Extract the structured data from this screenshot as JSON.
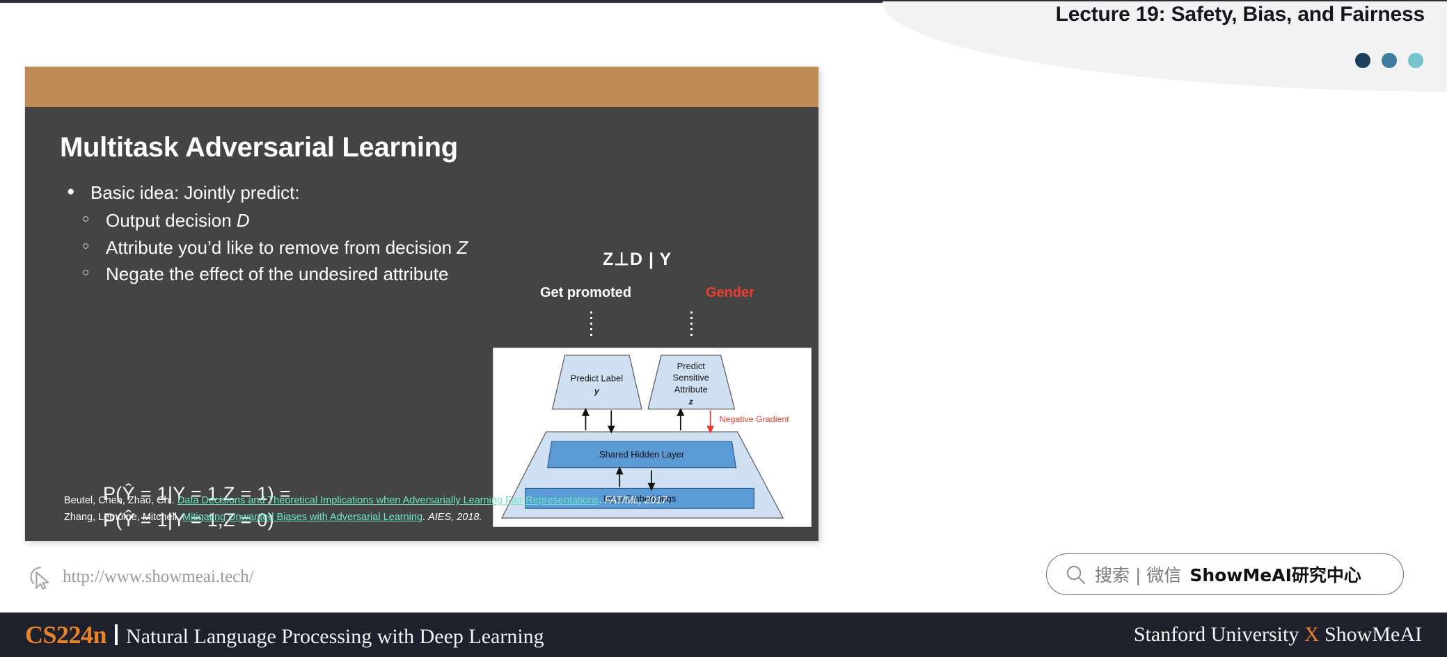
{
  "header": {
    "title": "Lecture 19: Safety, Bias, and Fairness",
    "dots": [
      "dot-dark-navy",
      "dot-steel-blue",
      "dot-light-cyan"
    ]
  },
  "slide": {
    "title": "Multitask Adversarial Learning",
    "accent_band_color": "#bf8c58",
    "background_color": "#444444",
    "bullet_level1": "Basic idea: Jointly predict:",
    "bullets_level2": [
      {
        "text": "Output decision ",
        "emph": "D"
      },
      {
        "text": "Attribute you’d like to remove from decision ",
        "emph": "Z"
      },
      {
        "text": "Negate the effect of the undesired attribute",
        "emph": ""
      }
    ],
    "equations": [
      "P(Ŷ = 1|Y = 1,Z = 1) =",
      "P(Ŷ = 1|Y = 1,Z = 0)"
    ],
    "citations": [
      {
        "authors": "Beutel, Chen, Zhao, Chi.",
        "link": "Data Decisions and Theoretical Implications when Adversarially Learning Fair Representations",
        "period": ".",
        "venue": "FAT/ML, 2017."
      },
      {
        "authors": "Zhang, Lemoine, Mitchell.",
        "link": "Mitigating Unwanted Biases with Adversarial Learning",
        "period": ".",
        "venue": "AIES, 2018."
      }
    ],
    "citation_link_color": "#6fe6c8"
  },
  "diagram": {
    "independence": "Z⊥D | Y",
    "label_left": "Get promoted",
    "label_right": "Gender",
    "label_right_color": "#ef3b2c",
    "head_left_line1": "Predict Label",
    "head_left_line2": "y",
    "head_right_line1": "Predict",
    "head_right_line2": "Sensitive",
    "head_right_line3": "Attribute",
    "head_right_line4": "z",
    "negative_gradient": "Negative Gradient",
    "shared_hidden": "Shared Hidden Layer",
    "input_embeddings": "Input Embeddings",
    "trunk_fill": "#cfe0f2",
    "inner_fill": "#5b9bd5"
  },
  "watermark": {
    "url": "http://www.showmeai.tech/",
    "cursor_icon": "cursor-arrow-icon"
  },
  "search_pill": {
    "magnifier_icon": "search-icon",
    "plain_text": "搜索 | 微信",
    "bold_text": "ShowMeAI研究中心"
  },
  "bottom_bar": {
    "course": "CS224n",
    "subject": "Natural Language Processing with Deep Learning",
    "right_prefix": "Stanford University ",
    "right_x": "X",
    "right_suffix": " ShowMeAI",
    "accent_color": "#e8832a",
    "background_color": "#1e212b"
  }
}
